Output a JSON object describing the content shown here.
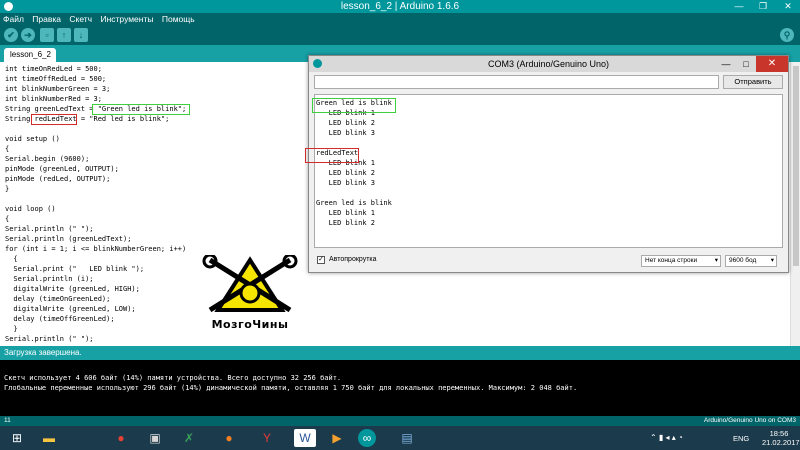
{
  "window": {
    "title": "lesson_6_2 | Arduino 1.6.6"
  },
  "menu": {
    "items": [
      "Файл",
      "Правка",
      "Скетч",
      "Инструменты",
      "Помощь"
    ]
  },
  "toolbar": {
    "verify": "✔",
    "upload": "➔",
    "new": "▫",
    "open": "↑",
    "save": "↓",
    "monitor": "⚲"
  },
  "tab": {
    "label": "lesson_6_2"
  },
  "code": [
    "int timeOnRedLed = 500;",
    "int timeOffRedLed = 500;",
    "int blinkNumberGreen = 3;",
    "int blinkNumberRed = 3;",
    "String greenLedText = \"Green led is blink\";",
    "String redLedText = \"Red led is blink\";",
    "",
    "void setup ()",
    "{",
    "Serial.begin (9600);",
    "pinMode (greenLed, OUTPUT);",
    "pinMode (redLed, OUTPUT);",
    "}",
    "",
    "void loop ()",
    "{",
    "Serial.println (\" \");",
    "Serial.println (greenLedText);",
    "for (int i = 1; i <= blinkNumberGreen; i++)",
    "  {",
    "  Serial.print (\"   LED blink \");",
    "  Serial.println (i);",
    "  digitalWrite (greenLed, HIGH);",
    "  delay (timeOnGreenLed);",
    "  digitalWrite (greenLed, LOW);",
    "  delay (timeOffGreenLed);",
    "  }",
    "Serial.println (\" \");"
  ],
  "status": {
    "text": "Загрузка завершена."
  },
  "console": {
    "lines": [
      "Скетч использует 4 606 байт (14%) памяти устройства. Всего доступно 32 256 байт.",
      "Глобальные переменные используют 296 байт (14%) динамической памяти, оставляя 1 750 байт для локальных переменных. Максимум: 2 048 байт."
    ]
  },
  "bottom": {
    "line": "11",
    "board": "Arduino/Genuino Uno on COM3"
  },
  "serial_monitor": {
    "title": "COM3 (Arduino/Genuino Uno)",
    "input_value": "",
    "send_label": "Отправить",
    "output": [
      "Green led is blink",
      "   LED blink 1",
      "   LED blink 2",
      "   LED blink 3",
      "",
      "redLedText",
      "   LED blink 1",
      "   LED blink 2",
      "   LED blink 3",
      "",
      "Green led is blink",
      "   LED blink 1",
      "   LED blink 2"
    ],
    "autoscroll_label": "Автопрокрутка",
    "autoscroll_checked": true,
    "line_ending": "Нет конца строки",
    "baud": "9600 бод"
  },
  "logo": {
    "text": "МозгоЧины"
  },
  "taskbar": {
    "lang": "ENG",
    "time": "18:56",
    "date": "21.02.2017",
    "apps": [
      "windows-icon",
      "folder-icon",
      "chrome-icon",
      "save-icon",
      "excel-icon",
      "firefox-icon",
      "yandex-icon",
      "word-icon",
      "media-icon",
      "arduino-icon",
      "tool-icon"
    ]
  },
  "colors": {
    "teal": "#00979c",
    "dark_teal": "#006468",
    "green_highlight": "#3ecf3e",
    "red_highlight": "#d42a2a"
  }
}
